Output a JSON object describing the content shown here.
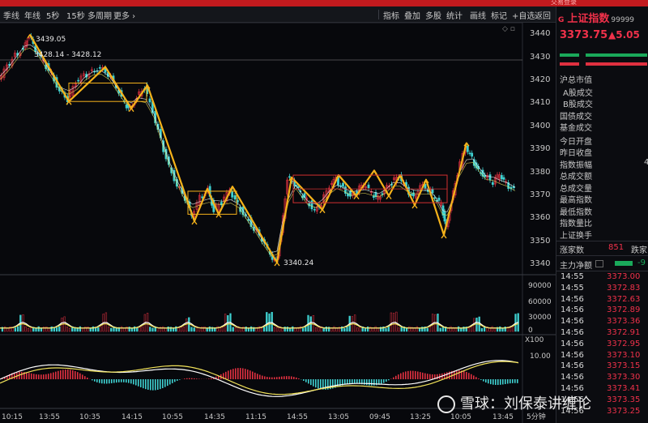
{
  "window": {
    "title_fragment": "交易登录"
  },
  "toolbar": {
    "left": [
      "季线",
      "年线",
      "5秒",
      "15秒",
      "多周期",
      "更多 ›"
    ],
    "right": [
      "指标",
      "叠加",
      "多股",
      "统计",
      "画线",
      "标记",
      "+自选",
      "返回"
    ]
  },
  "chart": {
    "price_axis": [
      "3440",
      "3430",
      "3420",
      "3410",
      "3400",
      "3390",
      "3380",
      "3370",
      "3360",
      "3350",
      "3340"
    ],
    "annotations": {
      "high": "3439.05",
      "range": "3428.14 - 3428.12",
      "low": "3340.24"
    },
    "volume_axis": [
      "90000",
      "60000",
      "30000",
      "0",
      "X100"
    ],
    "macd_axis": [
      "10.00"
    ],
    "time_axis": [
      "10:15",
      "13:55",
      "10:35",
      "14:15",
      "10:55",
      "14:35",
      "11:15",
      "14:55",
      "13:05",
      "09:45",
      "13:25",
      "10:05",
      "13:45"
    ],
    "period_label": "5分钟",
    "colors": {
      "up": "#e03040",
      "down": "#3fd0d0",
      "pattern": "#f5b21a",
      "ma_white": "#ffffff",
      "ma_yellow": "#f2e35a"
    }
  },
  "sidebar": {
    "index_name": "上证指数",
    "prefix": "G",
    "code": "99999",
    "price": "3373.75",
    "change": "▲5.05",
    "labels": [
      "沪总市值",
      "A股成交",
      "B股成交",
      "国债成交",
      "基金成交",
      "今日开盘",
      "昨日收盘",
      "指数振幅",
      "总成交额",
      "总成交量",
      "最高指数",
      "最低指数",
      "指数量比",
      "上证换手"
    ],
    "amplitude_partial": "4",
    "rise_label": "涨家数",
    "rise_count": "851",
    "fall_label": "跌家",
    "main_label": "主力净额",
    "main_value": "-9",
    "ticks": [
      {
        "t": "14:55",
        "p": "3373.00"
      },
      {
        "t": "14:55",
        "p": "3372.83"
      },
      {
        "t": "14:56",
        "p": "3372.63"
      },
      {
        "t": "14:56",
        "p": "3372.89"
      },
      {
        "t": "14:56",
        "p": "3373.36"
      },
      {
        "t": "14:56",
        "p": "3372.91"
      },
      {
        "t": "14:56",
        "p": "3372.95"
      },
      {
        "t": "14:56",
        "p": "3373.10"
      },
      {
        "t": "14:56",
        "p": "3373.15"
      },
      {
        "t": "14:56",
        "p": "3373.30"
      },
      {
        "t": "14:56",
        "p": "3373.41"
      },
      {
        "t": "14:56",
        "p": "3373.35"
      },
      {
        "t": "14:56",
        "p": "3373.25"
      }
    ]
  },
  "watermark": "雪球：刘保泰讲缠论"
}
